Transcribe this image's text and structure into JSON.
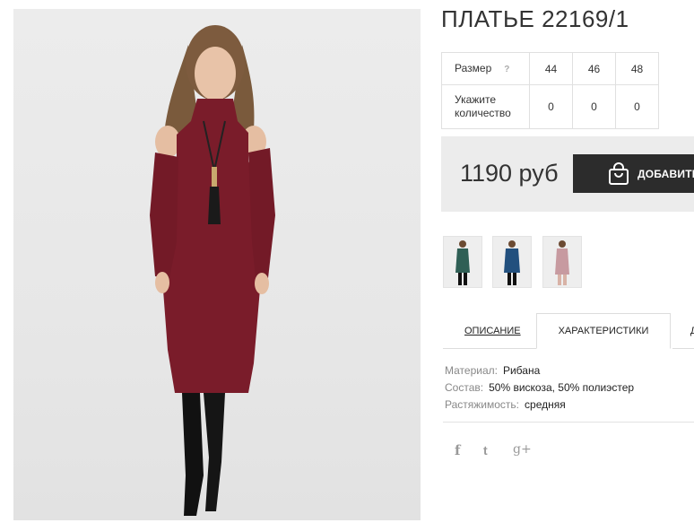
{
  "product": {
    "title": "ПЛАТЬЕ 22169/1",
    "price": "1190 руб",
    "add_button_label": "ДОБАВИТЬ"
  },
  "size_table": {
    "size_label": "Размер",
    "help_mark": "?",
    "sizes": [
      "44",
      "46",
      "48"
    ],
    "qty_label_line1": "Укажите",
    "qty_label_line2": "количество",
    "quantities": [
      "0",
      "0",
      "0"
    ]
  },
  "thumbnails": [
    {
      "color_name": "green",
      "color": "#2f5f55"
    },
    {
      "color_name": "blue",
      "color": "#22507e"
    },
    {
      "color_name": "pink",
      "color": "#c79aa0"
    }
  ],
  "tabs": {
    "description": "ОПИСАНИЕ",
    "characteristics": "ХАРАКТЕРИСТИКИ",
    "more": "Д"
  },
  "specs": [
    {
      "key": "Материал:",
      "value": "Рибана"
    },
    {
      "key": "Состав:",
      "value": "50% вискоза, 50% полиэстер"
    },
    {
      "key": "Растяжимость:",
      "value": "средняя"
    }
  ],
  "social": {
    "facebook": "f",
    "twitter": "t",
    "googleplus": "g+"
  },
  "colors": {
    "dress": "#7a1c2a",
    "button": "#2c2c2c",
    "price_bg": "#ececec"
  }
}
